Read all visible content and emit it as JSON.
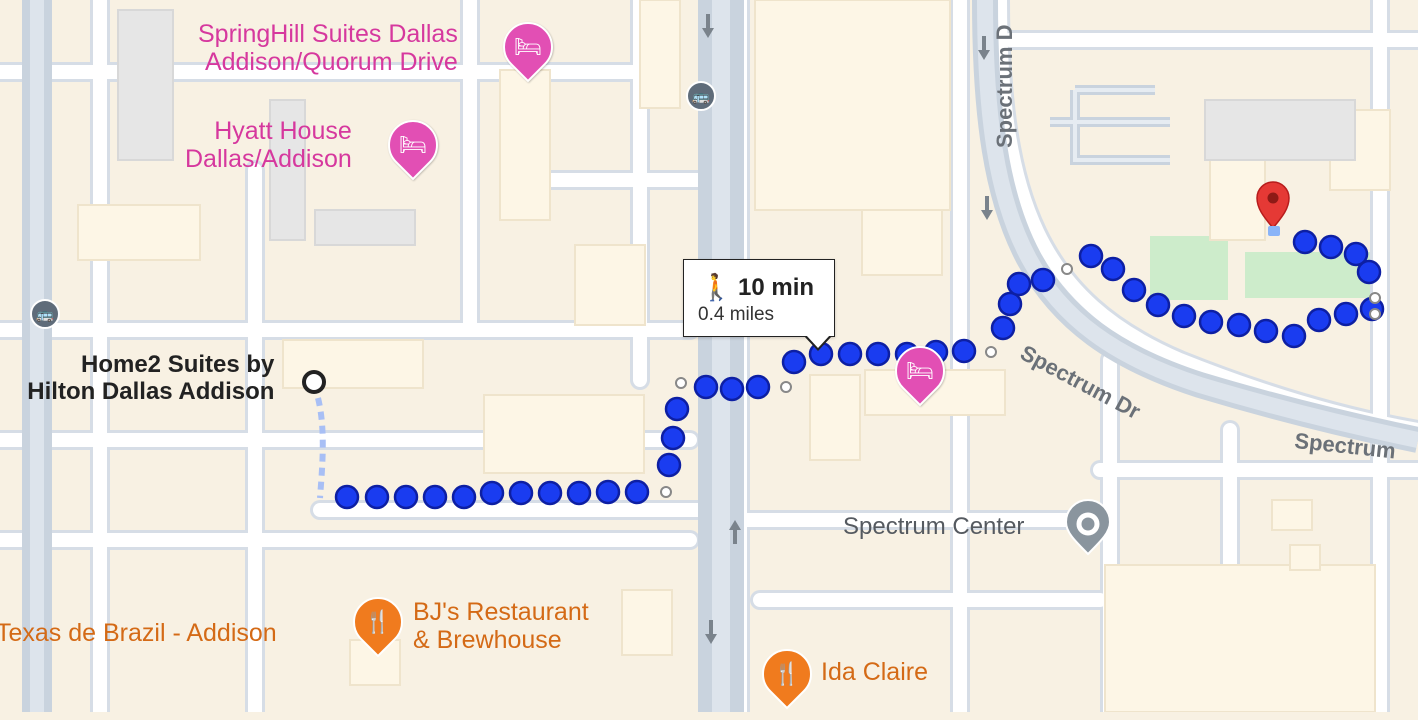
{
  "route": {
    "mode": "walking",
    "duration": "10 min",
    "distance": "0.4 miles",
    "route_color": "#1a3cf0",
    "route_outline": "#0d1fa3"
  },
  "origin": {
    "name_line1": "Home2 Suites by",
    "name_line2": "Hilton Dallas Addison"
  },
  "destination": {
    "marker": "red-pin"
  },
  "places": {
    "springhill": {
      "line1": "SpringHill Suites Dallas",
      "line2": "Addison/Quorum Drive"
    },
    "hyatt": {
      "line1": "Hyatt House",
      "line2": "Dallas/Addison"
    },
    "texas_de_brazil": {
      "name": "Texas de Brazil - Addison"
    },
    "bjs": {
      "line1": "BJ's Restaurant",
      "line2": "& Brewhouse"
    },
    "ida_claire": {
      "name": "Ida Claire"
    },
    "spectrum_center": {
      "name": "Spectrum Center"
    }
  },
  "roads": {
    "spectrum_dr_vertical": "Spectrum D",
    "spectrum_dr_diag": "Spectrum Dr",
    "spectrum_right": "Spectrum"
  },
  "colors": {
    "land": "#f8f1e3",
    "building": "#fdf6e6",
    "road": "#ffffff",
    "road_outline": "#d6dde6",
    "highway": "#c9d3de",
    "park": "#cdeccb",
    "hotel": "#e24fb4",
    "food": "#f07b1e",
    "place": "#8a959e"
  }
}
